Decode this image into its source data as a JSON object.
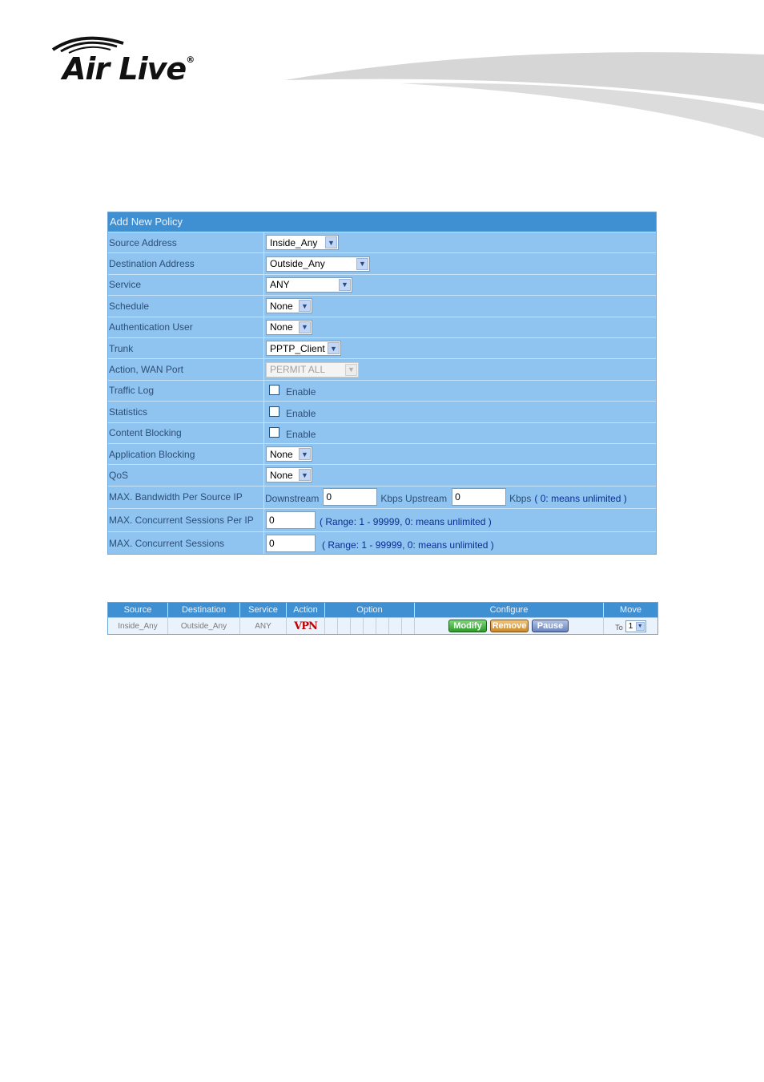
{
  "brand": {
    "logo_text": "Air Live",
    "registered_mark": "®"
  },
  "policy_form": {
    "title": "Add New Policy",
    "rows": [
      {
        "label": "Source Address",
        "value": "Inside_Any"
      },
      {
        "label": "Destination Address",
        "value": "Outside_Any"
      },
      {
        "label": "Service",
        "value": "ANY"
      },
      {
        "label": "Schedule",
        "value": "None"
      },
      {
        "label": "Authentication User",
        "value": "None"
      },
      {
        "label": "Trunk",
        "value": "PPTP_Client"
      },
      {
        "label": "Action, WAN Port",
        "value": "PERMIT ALL"
      },
      {
        "label": "Traffic Log",
        "value": "Enable"
      },
      {
        "label": "Statistics",
        "value": "Enable"
      },
      {
        "label": "Content Blocking",
        "value": "Enable"
      },
      {
        "label": "Application Blocking",
        "value": "None"
      },
      {
        "label": "QoS",
        "value": "None"
      },
      {
        "label": "MAX. Bandwidth Per Source IP",
        "downstream_label": "Downstream",
        "downstream_value": "0",
        "upstream_label": "Kbps Upstream",
        "upstream_value": "0",
        "unit": "Kbps",
        "hint": "( 0: means unlimited )"
      },
      {
        "label": "MAX. Concurrent Sessions Per IP",
        "value": "0",
        "hint": "( Range: 1 - 99999, 0: means unlimited )"
      },
      {
        "label": "MAX. Concurrent Sessions",
        "value": "0",
        "hint": "( Range: 1 - 99999, 0: means unlimited )"
      }
    ]
  },
  "policy_list": {
    "headers": [
      "Source",
      "Destination",
      "Service",
      "Action",
      "Option",
      "Configure",
      "Move"
    ],
    "row": {
      "source": "Inside_Any",
      "destination": "Outside_Any",
      "service": "ANY",
      "action": "VPN",
      "buttons": {
        "modify": "Modify",
        "remove": "Remove",
        "pause": "Pause"
      },
      "move_label": "To",
      "move_value": "1"
    }
  }
}
